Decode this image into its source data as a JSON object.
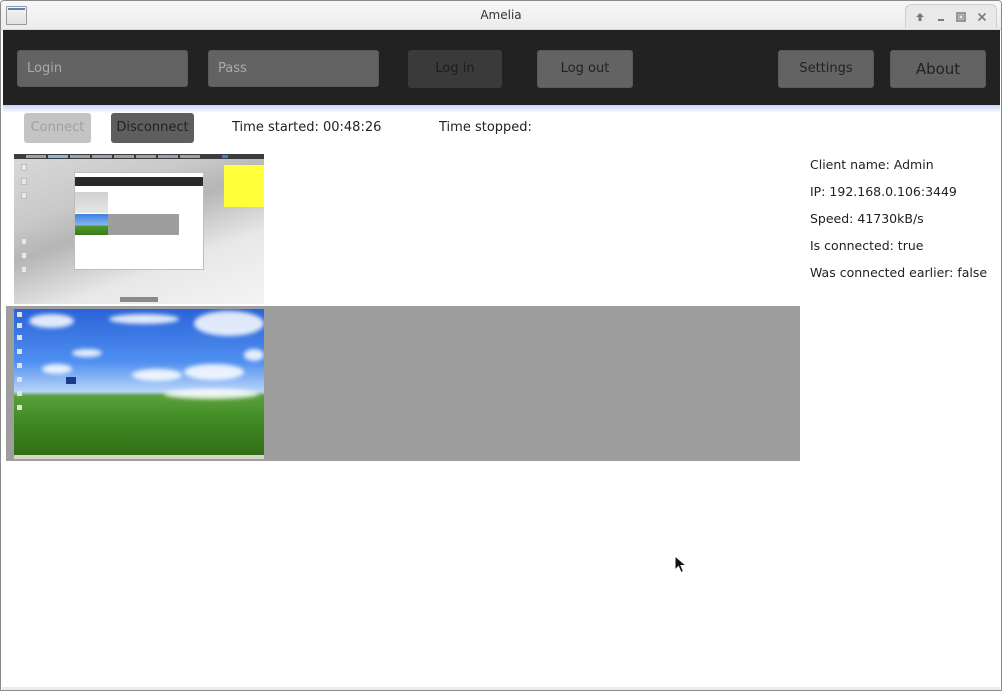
{
  "window": {
    "title": "Amelia",
    "controls": [
      {
        "name": "shade-icon",
        "glyph": "⇧"
      },
      {
        "name": "minimize-icon",
        "glyph": "_"
      },
      {
        "name": "maximize-icon",
        "glyph": "□"
      },
      {
        "name": "close-icon",
        "glyph": "×"
      }
    ]
  },
  "toolbar": {
    "login_placeholder": "Login",
    "login_value": "",
    "pass_placeholder": "Pass",
    "pass_value": "",
    "login_button": "Log in",
    "logout_button": "Log out",
    "settings_button": "Settings",
    "about_button": "About"
  },
  "controls": {
    "connect_button": "Connect",
    "disconnect_button": "Disconnect",
    "time_started": "Time started: 00:48:26",
    "time_stopped": "Time stopped:"
  },
  "clients": [
    {
      "thumbnail": "snowy-desktop-screenshot",
      "selected": false
    },
    {
      "thumbnail": "bliss-wallpaper-desktop-screenshot",
      "selected": true
    }
  ],
  "client_info": {
    "client_name": "Client name: Admin",
    "ip": "IP: 192.168.0.106:3449",
    "speed": "Speed: 41730kB/s",
    "is_connected": "Is connected: true",
    "was_connected_earlier": "Was connected earlier: false"
  },
  "colors": {
    "toolbar_bg": "#222222",
    "button_bg": "#636363",
    "selected_row": "#9e9e9e",
    "note_yellow": "#ffff3a"
  }
}
